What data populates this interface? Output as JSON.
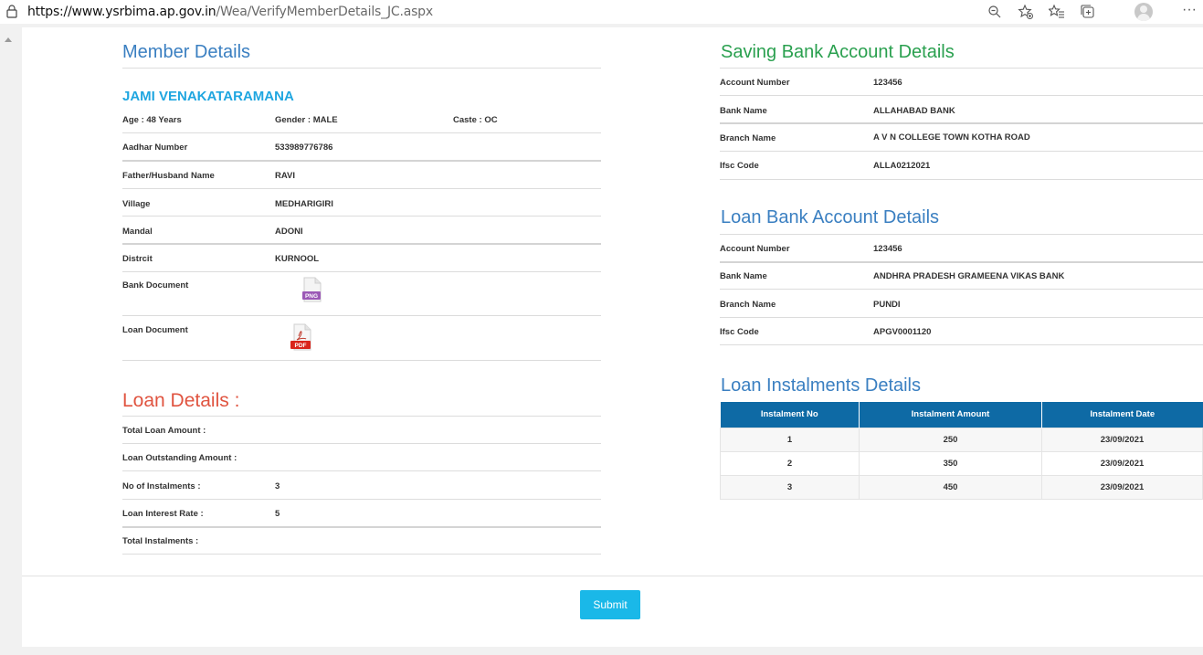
{
  "browser": {
    "url_host": "https://www.ysrbima.ap.gov.in",
    "url_path": "/Wea/VerifyMemberDetails_JC.aspx"
  },
  "member": {
    "title": "Member Details",
    "name": "JAMI VENAKATARAMANA",
    "age": "Age : 48 Years",
    "gender": "Gender : MALE",
    "caste": "Caste : OC",
    "rows": [
      {
        "label": "Aadhar Number",
        "value": "533989776786"
      },
      {
        "label": "Father/Husband Name",
        "value": "RAVI"
      },
      {
        "label": "Village",
        "value": "MEDHARIGIRI"
      },
      {
        "label": "Mandal",
        "value": "ADONI"
      },
      {
        "label": "Distrcit",
        "value": "KURNOOL"
      }
    ],
    "bank_document_label": "Bank Document",
    "bank_document_icon_text": "PNG",
    "loan_document_label": "Loan Document",
    "loan_document_icon_text": "PDF"
  },
  "loan": {
    "title": "Loan Details :",
    "rows": [
      {
        "label": "Total Loan Amount :",
        "value": ""
      },
      {
        "label": "Loan Outstanding Amount :",
        "value": ""
      },
      {
        "label": "No of Instalments :",
        "value": "3"
      },
      {
        "label": "Loan Interest Rate :",
        "value": "5"
      },
      {
        "label": "Total Instalments :",
        "value": ""
      }
    ]
  },
  "saving_bank": {
    "title": "Saving Bank Account Details",
    "rows": [
      {
        "label": "Account Number",
        "value": "123456"
      },
      {
        "label": "Bank Name",
        "value": "ALLAHABAD BANK"
      },
      {
        "label": "Branch Name",
        "value": "A V N COLLEGE TOWN KOTHA ROAD"
      },
      {
        "label": "Ifsc Code",
        "value": "ALLA0212021"
      }
    ]
  },
  "loan_bank": {
    "title": "Loan Bank Account Details",
    "rows": [
      {
        "label": "Account Number",
        "value": "123456"
      },
      {
        "label": "Bank Name",
        "value": "ANDHRA PRADESH GRAMEENA VIKAS BANK"
      },
      {
        "label": "Branch Name",
        "value": "PUNDI"
      },
      {
        "label": "Ifsc Code",
        "value": "APGV0001120"
      }
    ]
  },
  "instalments": {
    "title": "Loan Instalments Details",
    "headers": [
      "Instalment No",
      "Instalment Amount",
      "Instalment Date"
    ],
    "rows": [
      [
        "1",
        "250",
        "23/09/2021"
      ],
      [
        "2",
        "350",
        "23/09/2021"
      ],
      [
        "3",
        "450",
        "23/09/2021"
      ]
    ]
  },
  "submit_label": "Submit",
  "colors": {
    "member_heading": "#3a7fc1",
    "saving_heading": "#2aa04f",
    "loan_heading": "#e05440",
    "name": "#1fa6e0",
    "table_header": "#0e6aa5",
    "submit": "#1ab8e8"
  }
}
